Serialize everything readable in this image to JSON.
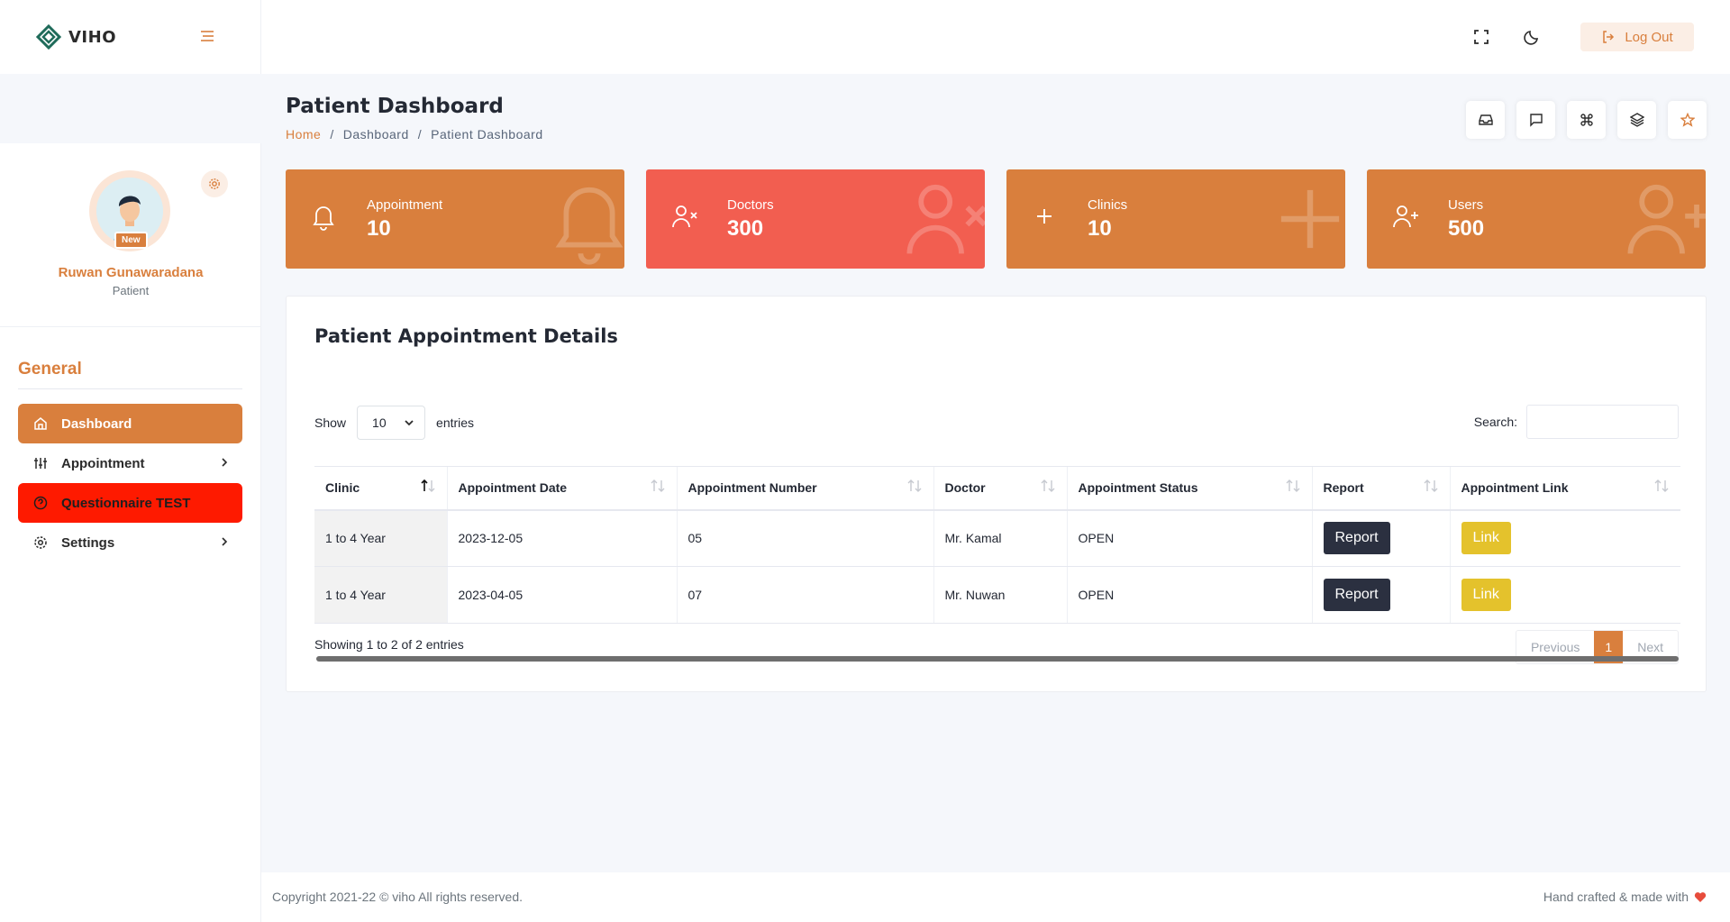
{
  "app": {
    "logo_text": "VIHO"
  },
  "header": {
    "logout_label": "Log Out"
  },
  "profile": {
    "name": "Ruwan Gunawaradana",
    "role": "Patient",
    "badge": "New"
  },
  "sidebar": {
    "section_title": "General",
    "items": [
      {
        "label": "Dashboard"
      },
      {
        "label": "Appointment"
      },
      {
        "label": "Questionnaire TEST"
      },
      {
        "label": "Settings"
      }
    ]
  },
  "page": {
    "title": "Patient Dashboard",
    "breadcrumb": [
      "Home",
      "/",
      "Dashboard",
      "/",
      "Patient Dashboard"
    ]
  },
  "stats": [
    {
      "label": "Appointment",
      "value": "10",
      "color": "#d97f3d"
    },
    {
      "label": "Doctors",
      "value": "300",
      "color": "#f25e50"
    },
    {
      "label": "Clinics",
      "value": "10",
      "color": "#d97f3d"
    },
    {
      "label": "Users",
      "value": "500",
      "color": "#d97f3d"
    }
  ],
  "panel": {
    "title": "Patient Appointment Details",
    "show_label": "Show",
    "entries_value": "10",
    "entries_label": "entries",
    "search_label": "Search:",
    "columns": [
      "Clinic",
      "Appointment Date",
      "Appointment Number",
      "Doctor",
      "Appointment Status",
      "Report",
      "Appointment Link"
    ],
    "rows": [
      {
        "clinic": "1 to 4 Year",
        "date": "2023-12-05",
        "number": "05",
        "doctor": "Mr. Kamal",
        "status": "OPEN",
        "report": "Report",
        "link": "Link"
      },
      {
        "clinic": "1 to 4 Year",
        "date": "2023-04-05",
        "number": "07",
        "doctor": "Mr. Nuwan",
        "status": "OPEN",
        "report": "Report",
        "link": "Link"
      }
    ],
    "info": "Showing 1 to 2 of 2 entries",
    "pager": {
      "prev": "Previous",
      "current": "1",
      "next": "Next"
    }
  },
  "footer": {
    "copyright": "Copyright 2021-22 © viho All rights reserved.",
    "crafted": "Hand crafted & made with"
  },
  "colors": {
    "accent": "#d97f3d",
    "danger": "#fe1a00",
    "doctors": "#f25e50",
    "link_button": "#e4c22c",
    "report_button": "#2b3040"
  }
}
